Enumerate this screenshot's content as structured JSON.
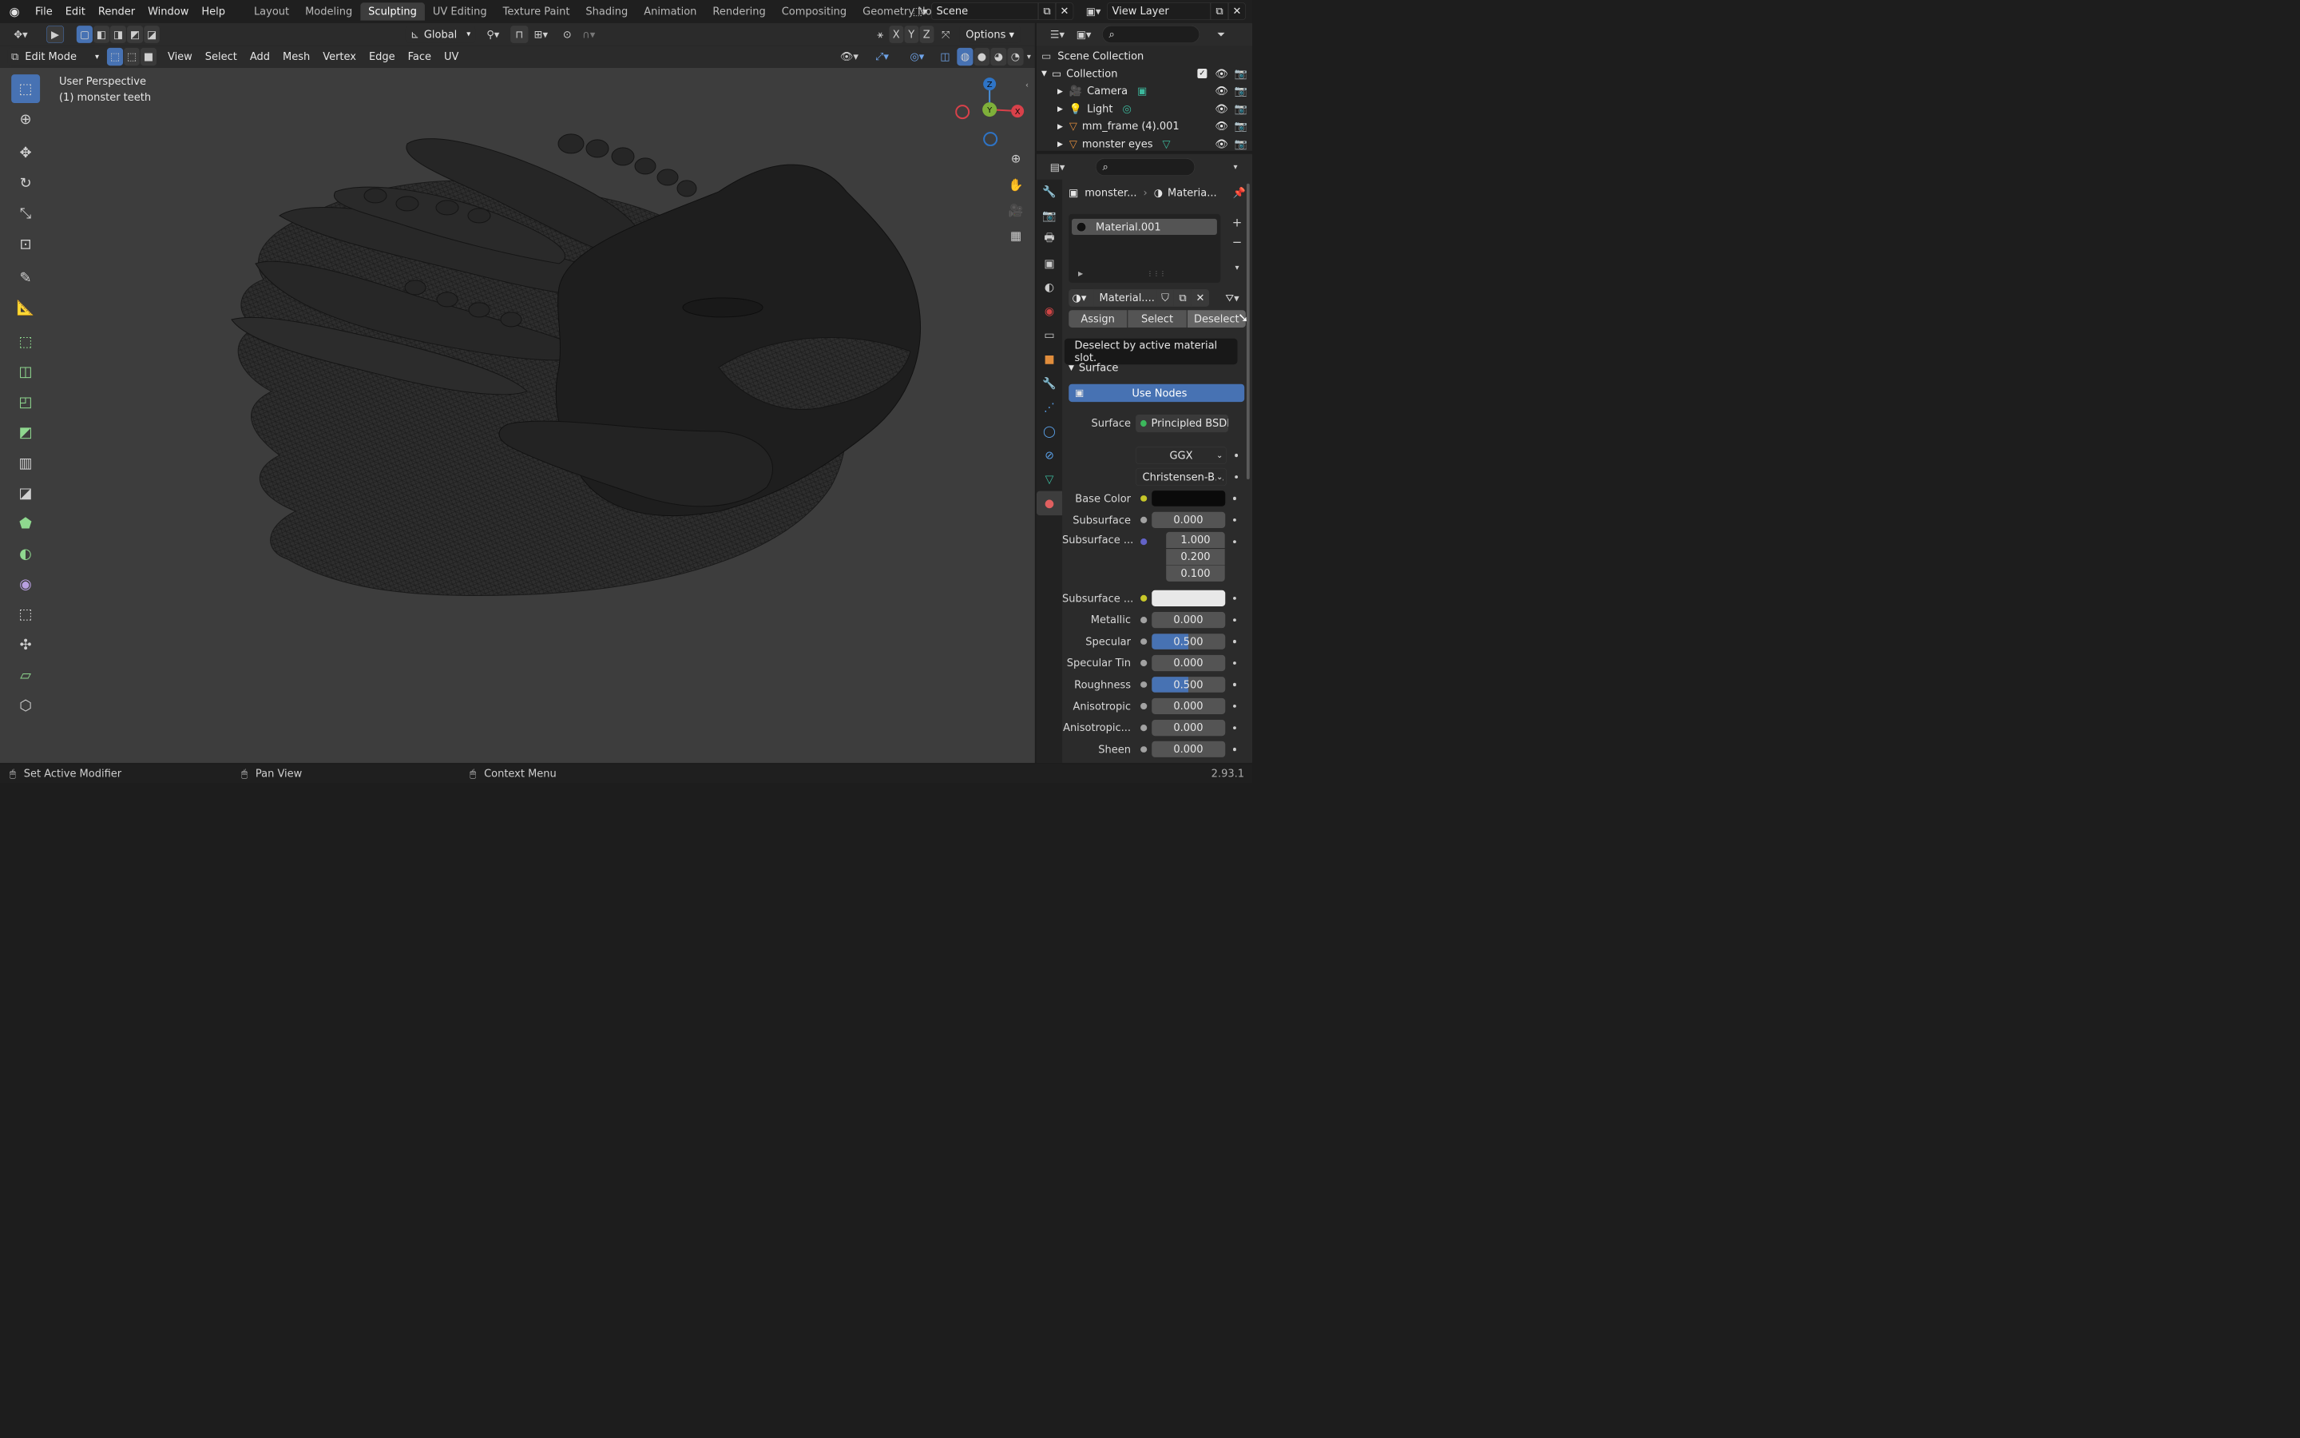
{
  "topbar": {
    "menus": [
      "File",
      "Edit",
      "Render",
      "Window",
      "Help"
    ],
    "workspaces": [
      "Layout",
      "Modeling",
      "Sculpting",
      "UV Editing",
      "Texture Paint",
      "Shading",
      "Animation",
      "Rendering",
      "Compositing",
      "Geometry Nodes",
      "S"
    ],
    "active_workspace": "Sculpting",
    "scene": "Scene",
    "view_layer": "View Layer"
  },
  "header": {
    "transform_orientation": "Global",
    "options_label": "Options",
    "axis_x": "X",
    "axis_y": "Y",
    "axis_z": "Z"
  },
  "header2": {
    "mode": "Edit Mode",
    "menus": [
      "View",
      "Select",
      "Add",
      "Mesh",
      "Vertex",
      "Edge",
      "Face",
      "UV"
    ]
  },
  "viewport": {
    "perspective": "User Perspective",
    "object": "(1) monster teeth",
    "gizmo": {
      "x": "X",
      "y": "Y",
      "z": "Z"
    }
  },
  "outliner": {
    "root": "Scene Collection",
    "collection": "Collection",
    "items": [
      {
        "name": "Camera",
        "icon": "camera-icon"
      },
      {
        "name": "Light",
        "icon": "light-icon"
      },
      {
        "name": "mm_frame (4).001",
        "icon": "mesh-icon"
      },
      {
        "name": "monster eyes",
        "icon": "mesh-icon"
      }
    ]
  },
  "properties": {
    "breadcrumb_object": "monster...",
    "breadcrumb_material": "Materia...",
    "material_slot": "Material.001",
    "material_name": "Material....",
    "assign": "Assign",
    "select": "Select",
    "deselect": "Deselect",
    "tooltip": "Deselect by active material slot.",
    "surface_panel": "Surface",
    "use_nodes": "Use Nodes",
    "surface_label": "Surface",
    "surface_shader": "Principled BSDF",
    "distribution": "GGX",
    "subsurface_method": "Christensen-B...",
    "fields": [
      {
        "label": "Base Color",
        "type": "color",
        "color": "#000000",
        "socket": "#c7c729"
      },
      {
        "label": "Subsurface",
        "value": "0.000",
        "fill": 0
      },
      {
        "label": "Subsurface ...",
        "values": [
          "1.000",
          "0.200",
          "0.100"
        ],
        "socket": "#6363c7"
      },
      {
        "label": "Subsurface ...",
        "type": "color",
        "color": "#e8e8e8",
        "socket": "#c7c729"
      },
      {
        "label": "Metallic",
        "value": "0.000",
        "fill": 0
      },
      {
        "label": "Specular",
        "value": "0.500",
        "fill": 0.5
      },
      {
        "label": "Specular Tin",
        "value": "0.000",
        "fill": 0
      },
      {
        "label": "Roughness",
        "value": "0.500",
        "fill": 0.5
      },
      {
        "label": "Anisotropic",
        "value": "0.000",
        "fill": 0
      },
      {
        "label": "Anisotropic...",
        "value": "0.000",
        "fill": 0
      },
      {
        "label": "Sheen",
        "value": "0.000",
        "fill": 0
      }
    ]
  },
  "statusbar": {
    "left": "Set Active Modifier",
    "middle": "Pan View",
    "right": "Context Menu",
    "version": "2.93.1"
  },
  "colors": {
    "accent": "#4772b3",
    "bg": "#3d3d3d",
    "panel": "#2b2b2b"
  }
}
